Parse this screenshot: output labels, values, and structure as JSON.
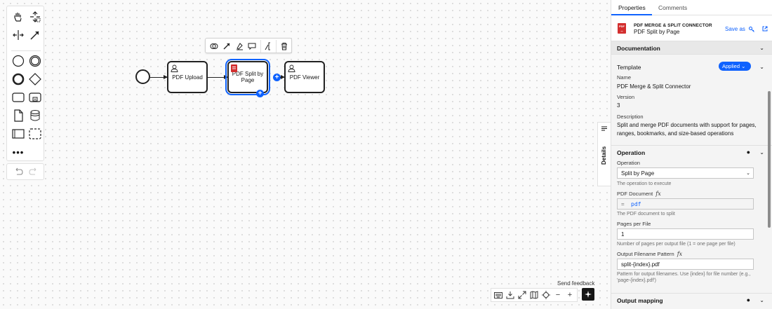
{
  "canvas": {
    "tasks": [
      {
        "label": "PDF Upload"
      },
      {
        "label": "PDF Split by Page"
      },
      {
        "label": "PDF Viewer"
      }
    ]
  },
  "bottom": {
    "send_feedback": "Send feedback"
  },
  "panel": {
    "tabs": [
      {
        "label": "Properties"
      },
      {
        "label": "Comments"
      }
    ],
    "header": {
      "type": "PDF MERGE & SPLIT CONNECTOR",
      "name": "PDF Split by Page",
      "save_as": "Save as"
    },
    "details_tab": "Details",
    "sections": {
      "documentation": "Documentation",
      "template": {
        "title": "Template",
        "badge": "Applied",
        "name_label": "Name",
        "name_value": "PDF Merge & Split Connector",
        "version_label": "Version",
        "version_value": "3",
        "description_label": "Description",
        "description_value": "Split and merge PDF documents with support for pages, ranges, bookmarks, and size-based operations"
      },
      "operation": {
        "title": "Operation",
        "operation_label": "Operation",
        "operation_value": "Split by Page",
        "operation_help": "The operation to execute",
        "pdf_label": "PDF Document",
        "pdf_value": "pdf",
        "pdf_help": "The PDF document to split",
        "pages_label": "Pages per File",
        "pages_value": "1",
        "pages_help": "Number of pages per output file (1 = one page per file)",
        "pattern_label": "Output Filename Pattern",
        "pattern_value": "split-{index}.pdf",
        "pattern_help": "Pattern for output filenames. Use {index} for file number (e.g., 'page-{index}.pdf')"
      },
      "output_mapping": "Output mapping"
    }
  }
}
